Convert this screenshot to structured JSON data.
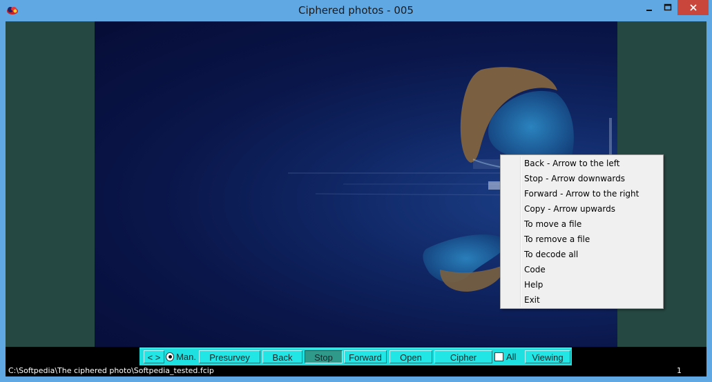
{
  "window": {
    "title": "Ciphered photos - 005"
  },
  "toolbar": {
    "nav_label": "< >",
    "manual_label": "Man.",
    "presurvey_label": "Presurvey",
    "back_label": "Back",
    "stop_label": "Stop",
    "forward_label": "Forward",
    "open_label": "Open",
    "cipher_label": "Cipher",
    "all_label": "All",
    "viewing_label": "Viewing"
  },
  "status": {
    "path": "C:\\Softpedia\\The ciphered photo\\Softpedia_tested.fcip",
    "count": "1"
  },
  "context_menu": {
    "items": [
      "Back - Arrow to the left",
      "Stop - Arrow downwards",
      "Forward - Arrow to the right",
      "Copy - Arrow upwards",
      "To move a file",
      "To remove a file",
      "To decode all",
      "Code",
      "Help",
      "Exit"
    ]
  },
  "colors": {
    "titlebar": "#5fa8e4",
    "close_button": "#c9463d",
    "viewer_background": "#264842",
    "toolbar": "#1ee0e0",
    "active_button": "#2f9a8a"
  }
}
